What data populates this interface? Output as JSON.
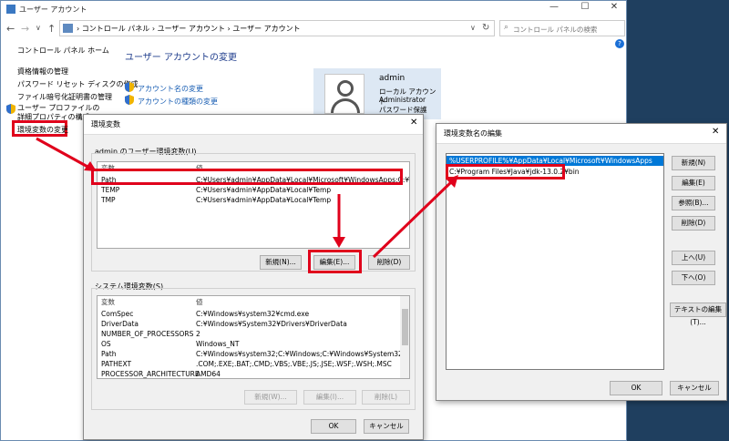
{
  "background_window": {
    "title": "ユーザー アカウント",
    "breadcrumb": [
      "コントロール パネル",
      "ユーザー アカウント",
      "ユーザー アカウント"
    ],
    "search_placeholder": "コントロール パネルの検索",
    "sidebar": [
      "コントロール パネル ホーム",
      "資格情報の管理",
      "パスワード リセット ディスクの作成",
      "ファイル暗号化証明書の管理",
      "ユーザー プロファイルの詳細プロパティの構成",
      "環境変数の変更"
    ],
    "heading": "ユーザー アカウントの変更",
    "links": [
      "アカウント名の変更",
      "アカウントの種類の変更"
    ],
    "user": {
      "name": "admin",
      "type": "ローカル アカウント",
      "role": "Administrator",
      "password": "パスワード保護"
    }
  },
  "env_dialog": {
    "title": "環境変数",
    "user_group_label": "admin のユーザー環境変数(U)",
    "col_var": "変数",
    "col_val": "値",
    "user_vars": [
      {
        "name": "Path",
        "value": "C:¥Users¥admin¥AppData¥Local¥Microsoft¥WindowsApps;C:¥Progr..."
      },
      {
        "name": "TEMP",
        "value": "C:¥Users¥admin¥AppData¥Local¥Temp"
      },
      {
        "name": "TMP",
        "value": "C:¥Users¥admin¥AppData¥Local¥Temp"
      }
    ],
    "user_buttons": {
      "new": "新規(N)...",
      "edit": "編集(E)...",
      "delete": "削除(D)"
    },
    "system_group_label": "システム環境変数(S)",
    "system_vars": [
      {
        "name": "ComSpec",
        "value": "C:¥Windows¥system32¥cmd.exe"
      },
      {
        "name": "DriverData",
        "value": "C:¥Windows¥System32¥Drivers¥DriverData"
      },
      {
        "name": "NUMBER_OF_PROCESSORS",
        "value": "2"
      },
      {
        "name": "OS",
        "value": "Windows_NT"
      },
      {
        "name": "Path",
        "value": "C:¥Windows¥system32;C:¥Windows;C:¥Windows¥System32¥Wbem;..."
      },
      {
        "name": "PATHEXT",
        "value": ".COM;.EXE;.BAT;.CMD;.VBS;.VBE;.JS;.JSE;.WSF;.WSH;.MSC"
      },
      {
        "name": "PROCESSOR_ARCHITECTURE",
        "value": "AMD64"
      }
    ],
    "system_buttons": {
      "new": "新規(W)...",
      "edit": "編集(I)...",
      "delete": "削除(L)"
    },
    "ok": "OK",
    "cancel": "キャンセル"
  },
  "edit_dialog": {
    "title": "環境変数名の編集",
    "entries": [
      "%USERPROFILE%¥AppData¥Local¥Microsoft¥WindowsApps",
      "C:¥Program Files¥Java¥jdk-13.0.2¥bin"
    ],
    "buttons": {
      "new": "新規(N)",
      "edit": "編集(E)",
      "browse": "参照(B)...",
      "delete": "削除(D)",
      "up": "上へ(U)",
      "down": "下へ(O)",
      "text_edit": "テキストの編集(T)..."
    },
    "ok": "OK",
    "cancel": "キャンセル"
  },
  "colors": {
    "highlight": "#e0001b",
    "selection": "#0078d7",
    "link": "#1a5fb4"
  }
}
